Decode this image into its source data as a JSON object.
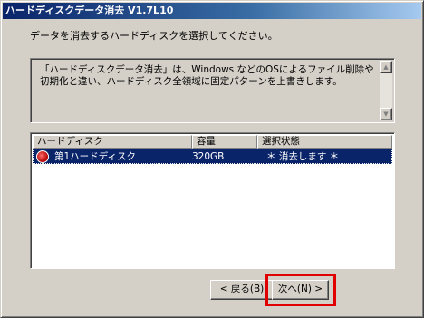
{
  "window": {
    "title": "ハードディスクデータ消去 V1.7L10"
  },
  "prompt": "データを消去するハードディスクを選択してください。",
  "description": "「ハードディスクデータ消去」は、Windows などのOSによるファイル削除や初期化と違い、ハードディスク全領域に固定パターンを上書きします。",
  "scrollbar": {
    "up_icon": "▲",
    "down_icon": "▼"
  },
  "list": {
    "headers": [
      "ハードディスク",
      "容量",
      "選択状態"
    ],
    "rows": [
      {
        "name": "第1ハードディスク",
        "size": "320GB",
        "state": "＊ 消去します ＊",
        "icon": "disk-icon"
      }
    ]
  },
  "buttons": {
    "back": "< 戻る(B)",
    "next": "次へ(N) >"
  },
  "colors": {
    "title_bar": "#0a246a",
    "selection": "#0a246a",
    "highlight_box": "#e00000"
  }
}
